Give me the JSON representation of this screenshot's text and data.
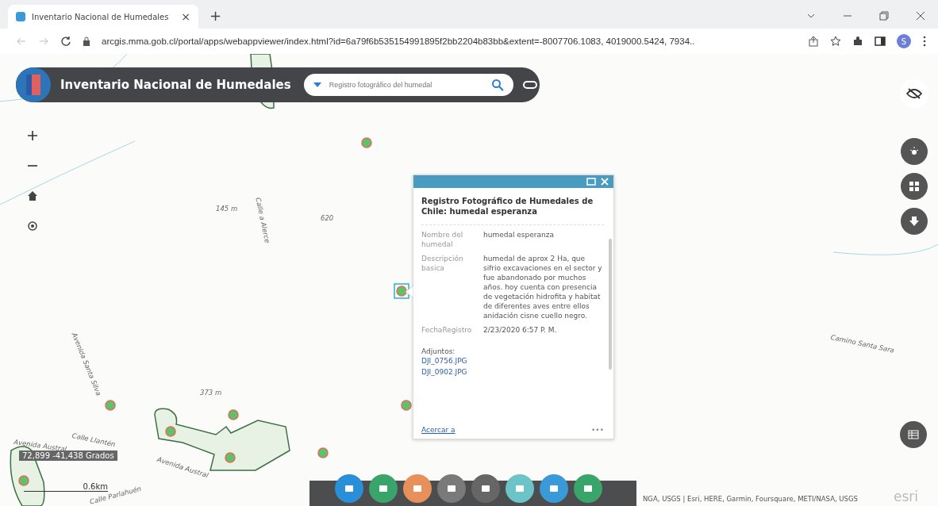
{
  "browser": {
    "tab_title": "Inventario Nacional de Humedales",
    "tab_close": "×",
    "new_tab": "+",
    "url": "arcgis.mma.gob.cl/portal/apps/webappviewer/index.html?id=6a79f6b535154991895f2bb2204b83bb&extent=-8007706.1083, 4019000.5424, 7934..",
    "avatar": "S"
  },
  "header": {
    "title": "Inventario Nacional de Humedales",
    "search": {
      "placeholder": "Registro fotográfico del humedal"
    }
  },
  "map_labels": [
    "Calle a Alerce",
    "145 m",
    "620",
    "373 m",
    "Calle Llantén",
    "Avenida Austral",
    "Avenida Austral",
    "Calle Parlahuén",
    "Camino Santa Sara",
    "Avenida Santa Silva"
  ],
  "popup": {
    "title": "Registro Fotográfico de Humedales de Chile: humedal esperanza",
    "fields": [
      {
        "label": "Nombre del humedal",
        "value": "humedal esperanza"
      },
      {
        "label": "Descripción basica",
        "value": "humedal de aprox 2 Ha, que sifrio excavaciones en el sector y fue abandonado por muchos años. hoy cuenta con presencia de vegetación hidrofita y habitat de diferentes aves entre ellos anidación cisne cuello negro."
      },
      {
        "label": "FechaRegistro",
        "value": "2/23/2020 6:57 P. M."
      }
    ],
    "attachments_label": "Adjuntos:",
    "attachments": [
      "DJI_0756.JPG",
      "DJI_0902.JPG"
    ],
    "zoom_link": "Acercar a",
    "more": "•••"
  },
  "coordinates": "72,899 -41,438 Grados",
  "scale": "0.6km",
  "widgets": [
    {
      "color": "#2a8fd6"
    },
    {
      "color": "#3aa56a"
    },
    {
      "color": "#e8905a"
    },
    {
      "color": "#7a7a7a"
    },
    {
      "color": "#666666"
    },
    {
      "color": "#6cc4c8"
    },
    {
      "color": "#3a9ad8"
    },
    {
      "color": "#3aa56a"
    }
  ],
  "attribution": "NGA, USGS | Esri, HERE, Garmin, Foursquare, METI/NASA, USGS",
  "logo": "esri"
}
